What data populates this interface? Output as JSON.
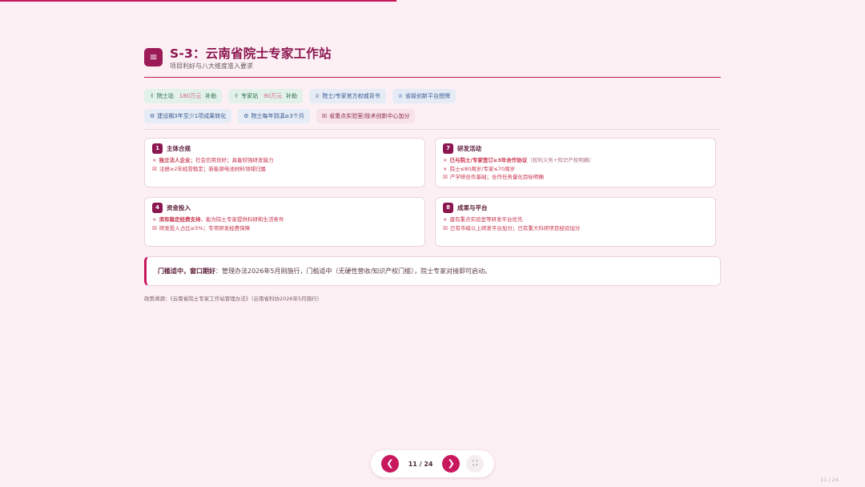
{
  "progress": {
    "value": 0.458
  },
  "header": {
    "menu_icon": "≡",
    "title": "S-3：云南省院士专家工作站",
    "subtitle": "项目利好与八大维度准入要求"
  },
  "tags": {
    "row1": [
      {
        "icon": "money-icon",
        "glyph": "✌",
        "label": "院士站",
        "amount": "180万元",
        "suffix": "补助",
        "color": "green"
      },
      {
        "icon": "money-icon",
        "glyph": "✌",
        "label": "专家站",
        "amount": "90万元",
        "suffix": "补助",
        "color": "green"
      },
      {
        "icon": "trophy-icon",
        "glyph": "♕",
        "label": "院士/专家官方权威背书",
        "color": "blue"
      },
      {
        "icon": "trophy-icon",
        "glyph": "♕",
        "label": "省级创新平台授牌",
        "color": "blue"
      }
    ],
    "row2": [
      {
        "icon": "gear-icon",
        "glyph": "⚙",
        "label": "建设期3年至少1项成果转化",
        "color": "blue"
      },
      {
        "icon": "gear-icon",
        "glyph": "⚙",
        "label": "院士每年到滇≥3个月",
        "color": "blue"
      },
      {
        "icon": "x-box-icon",
        "glyph": "☒",
        "label": "省重点实验室/技术创新中心加分",
        "color": "pink"
      }
    ]
  },
  "cards": [
    {
      "num": "1",
      "title": "主体合规",
      "lines": [
        {
          "mark": "×",
          "strong": "独立法人企业",
          "text": "；社会信用良好；具备较强研发能力"
        },
        {
          "mark": "☒",
          "text": "注册≥2年经营稳定；新能源电池材料领域归属"
        }
      ]
    },
    {
      "num": "7",
      "title": "研发活动",
      "lines": [
        {
          "mark": "×",
          "strong": "已与院士/专家签订≥3年合作协议",
          "muted": "（权利义务+知识产权明确）"
        },
        {
          "mark": "×",
          "text": "院士≤80周岁/专家≤70周岁"
        },
        {
          "mark": "☒",
          "text": "产学研合作基础；合作任务量化目标明确"
        }
      ]
    },
    {
      "num": "4",
      "title": "资金投入",
      "lines": [
        {
          "mark": "×",
          "strong": "须有稳定经费支持",
          "text": "，能为院士专家提供科研和生活条件"
        },
        {
          "mark": "☒",
          "text": "研发投入占比≥5%；专项研发经费保障"
        }
      ]
    },
    {
      "num": "8",
      "title": "成果与平台",
      "lines": [
        {
          "mark": "×",
          "text": "建有重点实验室等研发平台优先"
        },
        {
          "mark": "☒",
          "text": "已有市级以上研发平台加分；已有重大科研项目经验加分"
        }
      ]
    }
  ],
  "callout": {
    "lead": "门槛适中，窗口期好",
    "text": "：管理办法2026年5月刚施行，门槛适中（无硬性营收/知识产权门槛），院士专家对接即可启动。"
  },
  "source": "政策溯源：《云南省院士专家工作站管理办法》（云南省科协2026年5月施行）",
  "nav": {
    "prev": "❮",
    "next": "❯",
    "page": "11 / 24",
    "fullscreen": "⛶"
  },
  "corner_page": "11 / 24"
}
